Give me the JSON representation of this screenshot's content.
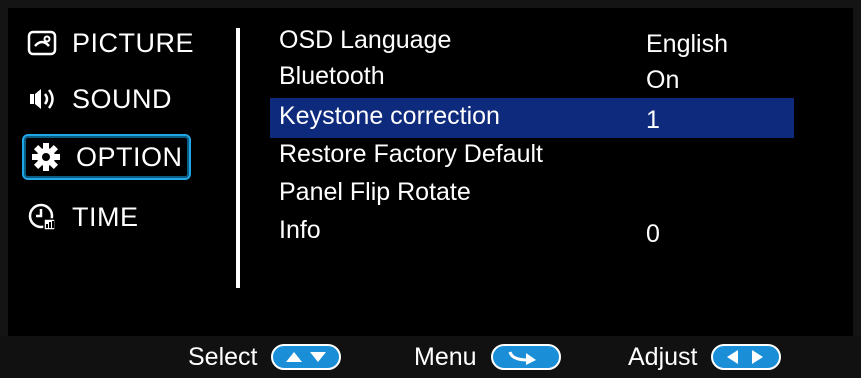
{
  "sidebar": {
    "items": [
      {
        "label": "PICTURE",
        "icon": "picture-icon"
      },
      {
        "label": "SOUND",
        "icon": "speaker-icon"
      },
      {
        "label": "OPTION",
        "icon": "gear-icon",
        "selected": true
      },
      {
        "label": "TIME",
        "icon": "clock-icon"
      }
    ]
  },
  "options": {
    "items": [
      {
        "label": "OSD Language",
        "value": "English"
      },
      {
        "label": "Bluetooth",
        "value": "On"
      },
      {
        "label": "Keystone correction",
        "value": "1",
        "highlighted": true
      },
      {
        "label": "Restore Factory Default",
        "value": ""
      },
      {
        "label": "Panel Flip Rotate",
        "value": ""
      },
      {
        "label": "Info",
        "value": "0"
      }
    ]
  },
  "footer": {
    "select_label": "Select",
    "menu_label": "Menu",
    "adjust_label": "Adjust"
  },
  "colors": {
    "highlight": "#0d2a7c",
    "accent": "#1fa7e6",
    "button": "#1a8fd8"
  }
}
